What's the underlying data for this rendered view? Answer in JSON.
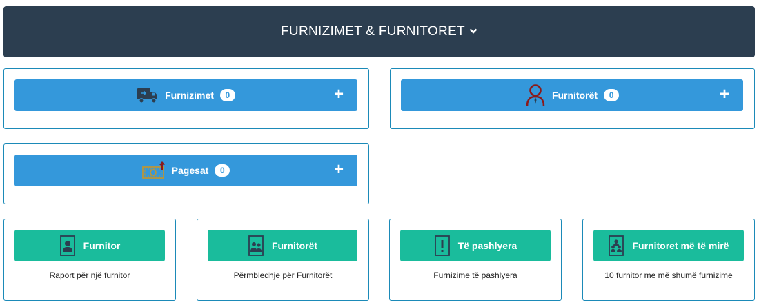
{
  "header": {
    "title": "FURNIZIMET & FURNITORET"
  },
  "modules": [
    {
      "label": "Furnizimet",
      "count": "0",
      "icon": "truck-icon"
    },
    {
      "label": "Furnitorët",
      "count": "0",
      "icon": "person-icon"
    },
    {
      "label": "Pagesat",
      "count": "0",
      "icon": "payment-icon"
    }
  ],
  "reports": [
    {
      "label": "Furnitor",
      "caption": "Raport për një furnitor",
      "icon": "user-document-icon"
    },
    {
      "label": "Furnitorët",
      "caption": "Përmbledhje për Furnitorët",
      "icon": "users-document-icon"
    },
    {
      "label": "Të pashlyera",
      "caption": "Furnizime të pashlyera",
      "icon": "exclamation-document-icon"
    },
    {
      "label": "Furnitoret më të mirë",
      "caption": "10 furnitor me më shumë furnizime",
      "icon": "top-users-document-icon"
    }
  ],
  "colors": {
    "header_bg": "#2c3e50",
    "module_btn": "#3498db",
    "report_btn": "#1abc9c",
    "panel_border": "#1b8ab8"
  }
}
